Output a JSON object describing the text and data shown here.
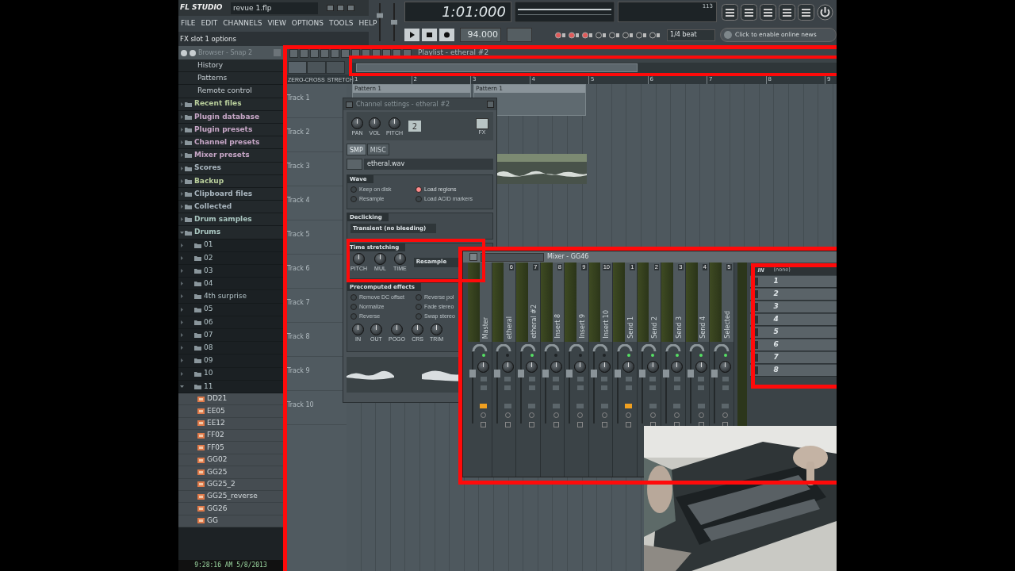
{
  "app": {
    "logo": "FL STUDIO",
    "file": "revue 1.flp"
  },
  "menu": [
    "FILE",
    "EDIT",
    "CHANNELS",
    "VIEW",
    "OPTIONS",
    "TOOLS",
    "HELP"
  ],
  "hint": "FX slot 1 options",
  "master_volume": {
    "level": 0.7
  },
  "master_pitch": {
    "level": 0.5
  },
  "transport": {
    "time": "1:01:000",
    "tempo": "94.000",
    "cpu": "113",
    "snap": "1/4 beat",
    "news": "Click to enable online news"
  },
  "browser": {
    "title": "Browser - Snap 2",
    "sub_items": [
      "History",
      "Patterns",
      "Remote control"
    ],
    "items": [
      {
        "label": "Recent files",
        "color": "#b9cf9c",
        "expanded": false
      },
      {
        "label": "Plugin database",
        "color": "#c6a6c6",
        "expanded": false
      },
      {
        "label": "Plugin presets",
        "color": "#c6a6c6",
        "expanded": false
      },
      {
        "label": "Channel presets",
        "color": "#c6a6c6",
        "expanded": false
      },
      {
        "label": "Mixer presets",
        "color": "#c6a6c6",
        "expanded": false
      },
      {
        "label": "Scores",
        "color": "#a9b6bf",
        "expanded": false
      },
      {
        "label": "Backup",
        "color": "#b9cf9c",
        "expanded": false
      },
      {
        "label": "Clipboard files",
        "color": "#a9b6bf",
        "expanded": false
      },
      {
        "label": "Collected",
        "color": "#a9b6bf",
        "expanded": false
      },
      {
        "label": "Drum samples",
        "color": "#a9c6c0",
        "expanded": false
      },
      {
        "label": "Drums",
        "color": "#a9c6c0",
        "expanded": true,
        "children": [
          {
            "label": "01",
            "expanded": false
          },
          {
            "label": "02",
            "expanded": false
          },
          {
            "label": "03",
            "expanded": false
          },
          {
            "label": "04",
            "expanded": false
          },
          {
            "label": "4th surprise",
            "expanded": false
          },
          {
            "label": "05",
            "expanded": false
          },
          {
            "label": "06",
            "expanded": false
          },
          {
            "label": "07",
            "expanded": false
          },
          {
            "label": "08",
            "expanded": false
          },
          {
            "label": "09",
            "expanded": false
          },
          {
            "label": "10",
            "expanded": false
          },
          {
            "label": "11",
            "expanded": true,
            "children": [
              {
                "label": "DD21"
              },
              {
                "label": "EE05"
              },
              {
                "label": "EE12"
              },
              {
                "label": "FF02"
              },
              {
                "label": "FF05"
              },
              {
                "label": "GG02"
              },
              {
                "label": "GG25"
              },
              {
                "label": "GG25_2"
              },
              {
                "label": "GG25_reverse"
              },
              {
                "label": "GG26"
              },
              {
                "label": "GG"
              }
            ]
          }
        ]
      }
    ],
    "clock": "9:28:16 AM 5/8/2013"
  },
  "playlist": {
    "title": "Playlist - etheral #2",
    "zero_cross": "ZERO-CROSS",
    "stretch": "STRETCH",
    "ruler": [
      "1",
      "2",
      "3",
      "4",
      "5",
      "6",
      "7",
      "8",
      "9"
    ],
    "tracks": [
      "Track 1",
      "Track 2",
      "Track 3",
      "Track 4",
      "Track 5",
      "Track 6",
      "Track 7",
      "Track 8",
      "Track 9",
      "Track 10"
    ],
    "clips": [
      {
        "label": "Pattern 1"
      },
      {
        "label": "Pattern 1"
      }
    ]
  },
  "channel": {
    "title": "Channel settings - etheral #2",
    "knobs": [
      "PAN",
      "VOL",
      "PITCH"
    ],
    "range": "2",
    "fx_label": "FX",
    "tabs": [
      {
        "label": "SMP",
        "selected": true
      },
      {
        "label": "MISC",
        "selected": false
      }
    ],
    "sample": "etheral.wav",
    "wave": {
      "title": "Wave",
      "options": [
        {
          "label": "Keep on disk",
          "on": false
        },
        {
          "label": "Resample",
          "on": false
        },
        {
          "label": "Load regions",
          "on": true
        },
        {
          "label": "Load ACID markers",
          "on": false
        }
      ]
    },
    "declicking": {
      "title": "Declicking",
      "mode": "Transient (no bleeding)"
    },
    "time_stretching": {
      "title": "Time stretching",
      "knobs": [
        "PITCH",
        "MUL",
        "TIME"
      ],
      "mode": "Resample"
    },
    "precomputed": {
      "title": "Precomputed effects",
      "options": [
        {
          "label": "Remove DC offset",
          "on": false
        },
        {
          "label": "Reverse pol",
          "on": false
        },
        {
          "label": "Normalize",
          "on": false
        },
        {
          "label": "Fade stereo",
          "on": false
        },
        {
          "label": "Reverse",
          "on": false
        },
        {
          "label": "Swap stereo",
          "on": false
        }
      ],
      "knobs": [
        "IN",
        "OUT",
        "POGO",
        "CRS",
        "TRIM"
      ]
    }
  },
  "mixer": {
    "title": "Mixer - GG46",
    "strips": [
      {
        "name": "Master",
        "led": true,
        "armed": true
      },
      {
        "name": "etheral",
        "number": "6",
        "led": false,
        "armed": false
      },
      {
        "name": "etheral #2",
        "number": "7",
        "led": true,
        "armed": false
      },
      {
        "name": "Insert 8",
        "number": "8",
        "led": false,
        "armed": false
      },
      {
        "name": "Insert 9",
        "number": "9",
        "led": false,
        "armed": false
      },
      {
        "name": "Insert 10",
        "number": "10",
        "led": false,
        "armed": false
      },
      {
        "name": "Send 1",
        "number": "1",
        "led": true,
        "armed": true
      },
      {
        "name": "Send 2",
        "number": "2",
        "led": true,
        "armed": false
      },
      {
        "name": "Send 3",
        "number": "3",
        "led": true,
        "armed": false
      },
      {
        "name": "Send 4",
        "number": "4",
        "led": true,
        "armed": false
      },
      {
        "name": "Selected",
        "number": "5",
        "led": true,
        "armed": false
      }
    ],
    "input": {
      "label": "IN",
      "value": "(none)"
    },
    "slots": [
      "1",
      "2",
      "3",
      "4",
      "5",
      "6",
      "7",
      "8"
    ]
  }
}
